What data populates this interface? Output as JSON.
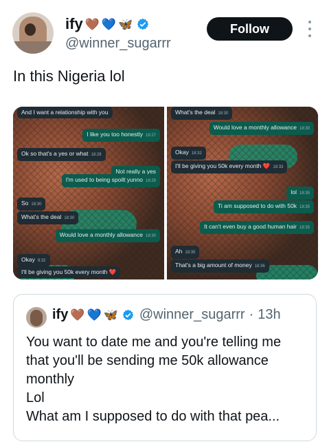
{
  "author": {
    "display_name": "ify",
    "emoji": [
      "🤎",
      "💙",
      "🦋"
    ],
    "handle": "@winner_sugarrr",
    "verified": true
  },
  "follow_label": "Follow",
  "tweet_text": "In this Nigeria lol",
  "media": {
    "left_chat": [
      {
        "dir": "in",
        "text": "And I want a relationship with you",
        "time": ""
      },
      {
        "dir": "out",
        "text": "I like you too honestly",
        "time": "18:27"
      },
      {
        "dir": "in",
        "text": "Ok so that's a yes or what",
        "time": "18:28"
      },
      {
        "dir": "out",
        "text": "Not really a yes",
        "time": ""
      },
      {
        "dir": "out",
        "text": "I'm used to being spoilt yunno",
        "time": "18:29"
      },
      {
        "dir": "in",
        "text": "So",
        "time": "18:30"
      },
      {
        "dir": "in",
        "text": "What's the deal",
        "time": "18:30"
      },
      {
        "dir": "out",
        "text": "Would love a monthly allowance",
        "time": "18:30"
      },
      {
        "dir": "in",
        "text": "Okay",
        "time": "9:32"
      },
      {
        "dir": "in",
        "text": "I'll be giving you 50k every month ❤️",
        "time": ""
      }
    ],
    "right_chat": [
      {
        "dir": "in",
        "text": "What's the deal",
        "time": "18:30"
      },
      {
        "dir": "out",
        "text": "Would love a monthly allowance",
        "time": "18:30"
      },
      {
        "dir": "in",
        "text": "Okay",
        "time": "18:32"
      },
      {
        "dir": "in",
        "text": "I'll be giving you 50k every month ❤️",
        "time": "18:33"
      },
      {
        "dir": "out",
        "text": "lol",
        "time": "18:35"
      },
      {
        "dir": "out",
        "text": "Ti am supposed to do with 50k",
        "time": "18:35"
      },
      {
        "dir": "out",
        "text": "It can't even buy a good human hair",
        "time": "18:35"
      },
      {
        "dir": "in",
        "text": "Ah",
        "time": "18:35"
      },
      {
        "dir": "in",
        "text": "That's a big amount of money",
        "time": "18:36"
      }
    ]
  },
  "quoted": {
    "display_name": "ify",
    "emoji": [
      "🤎",
      "💙",
      "🦋"
    ],
    "handle": "@winner_sugarrr",
    "separator": "·",
    "time": "13h",
    "lines": [
      "You want to date me and you're telling me",
      "that you'll be sending me 50k allowance",
      "monthly",
      "Lol",
      "What am I supposed to do with that pea..."
    ]
  }
}
